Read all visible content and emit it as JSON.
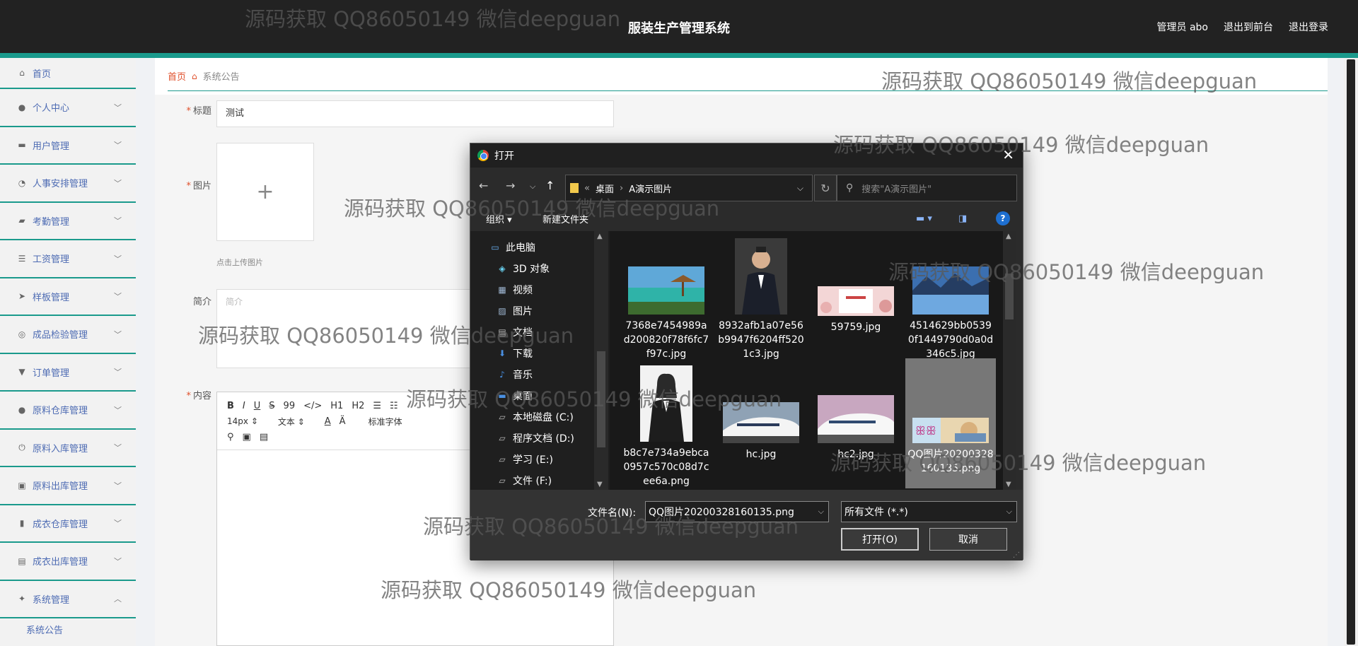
{
  "header": {
    "title": "服装生产管理系统",
    "links": [
      "管理员 abo",
      "退出到前台",
      "退出登录"
    ]
  },
  "sidebar": {
    "items": [
      {
        "label": "首页",
        "icon": "home-icon"
      },
      {
        "label": "个人中心",
        "icon": "user-icon"
      },
      {
        "label": "用户管理",
        "icon": "card-icon"
      },
      {
        "label": "人事安排管理",
        "icon": "gauge-icon"
      },
      {
        "label": "考勤管理",
        "icon": "chat-icon"
      },
      {
        "label": "工资管理",
        "icon": "list-icon"
      },
      {
        "label": "样板管理",
        "icon": "send-icon"
      },
      {
        "label": "成品检验管理",
        "icon": "target-icon"
      },
      {
        "label": "订单管理",
        "icon": "stamp-icon"
      },
      {
        "label": "原料仓库管理",
        "icon": "user-icon"
      },
      {
        "label": "原料入库管理",
        "icon": "power-icon"
      },
      {
        "label": "原料出库管理",
        "icon": "box-icon"
      },
      {
        "label": "成衣仓库管理",
        "icon": "bar-chart-icon"
      },
      {
        "label": "成衣出库管理",
        "icon": "clipboard-icon"
      },
      {
        "label": "系统管理",
        "icon": "settings-icon"
      }
    ],
    "sub_item": "系统公告"
  },
  "breadcrumb": {
    "home": "首页",
    "current": "系统公告"
  },
  "form": {
    "title_label": "标题",
    "title_value": "测试",
    "image_label": "图片",
    "upload_hint": "点击上传图片",
    "intro_label": "简介",
    "intro_placeholder": "简介",
    "content_label": "内容",
    "toolbar": {
      "buttons": [
        "B",
        "I",
        "U",
        "S",
        "99",
        "</>",
        "H1",
        "H2"
      ],
      "font_size": "14px",
      "font_type": "文本",
      "font_family": "标准字体"
    }
  },
  "watermark": "源码获取 QQ86050149 微信deepguan",
  "dialog": {
    "title": "打开",
    "path_prefix": "«",
    "path": [
      "桌面",
      "A演示图片"
    ],
    "search_placeholder": "搜索\"A演示图片\"",
    "organize": "组织 ▾",
    "new_folder": "新建文件夹",
    "tree": [
      {
        "label": "此电脑",
        "icon": "computer-icon"
      },
      {
        "label": "3D 对象",
        "icon": "cube-icon"
      },
      {
        "label": "视频",
        "icon": "video-icon"
      },
      {
        "label": "图片",
        "icon": "picture-icon"
      },
      {
        "label": "文档",
        "icon": "document-icon"
      },
      {
        "label": "下载",
        "icon": "download-icon"
      },
      {
        "label": "音乐",
        "icon": "music-icon"
      },
      {
        "label": "桌面",
        "icon": "desktop-icon"
      },
      {
        "label": "本地磁盘 (C:)",
        "icon": "drive-icon"
      },
      {
        "label": "程序文档 (D:)",
        "icon": "drive-icon"
      },
      {
        "label": "学习 (E:)",
        "icon": "drive-icon"
      },
      {
        "label": "文件 (F:)",
        "icon": "drive-icon"
      }
    ],
    "files": [
      {
        "name": "7368e7454989ad200820f78f6fc7f97c.jpg",
        "thumb": "beach"
      },
      {
        "name": "8932afb1a07e56b9947f6204ff5201c3.jpg",
        "thumb": "man"
      },
      {
        "name": "59759.jpg",
        "thumb": "banner"
      },
      {
        "name": "4514629bb05390f1449790d0a0d346c5.jpg",
        "thumb": "lake"
      },
      {
        "name": "b8c7e734a9ebca0957c570c08d7cee6a.png",
        "thumb": "woman"
      },
      {
        "name": "hc.jpg",
        "thumb": "train"
      },
      {
        "name": "hc2.jpg",
        "thumb": "train2"
      },
      {
        "name": "QQ图片20200328160135.png",
        "thumb": "art",
        "selected": true
      }
    ],
    "filename_label": "文件名(N):",
    "filename_value": "QQ图片20200328160135.png",
    "filetype_value": "所有文件 (*.*)",
    "open_button": "打开(O)",
    "cancel_button": "取消"
  }
}
